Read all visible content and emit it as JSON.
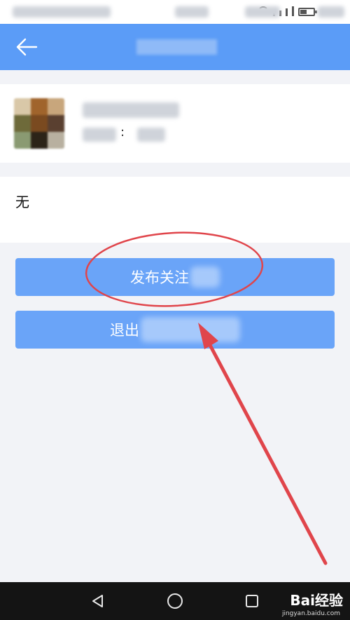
{
  "description": {
    "text": "无"
  },
  "buttons": {
    "follow_label": "发布关注",
    "exit_label": "退出"
  },
  "meta": {
    "separator": ":"
  },
  "watermark": {
    "brand": "Bai经验",
    "url": "jingyan.baidu.com"
  },
  "colors": {
    "nav_bar": "#5b9cf7",
    "button": "#6aa4f8",
    "annotation": "#e0454b",
    "page_bg": "#f2f3f7"
  },
  "icons": {
    "back": "arrow-left-icon",
    "sys_back": "triangle-back-icon",
    "sys_home": "circle-home-icon",
    "sys_recent": "square-recent-icon"
  }
}
